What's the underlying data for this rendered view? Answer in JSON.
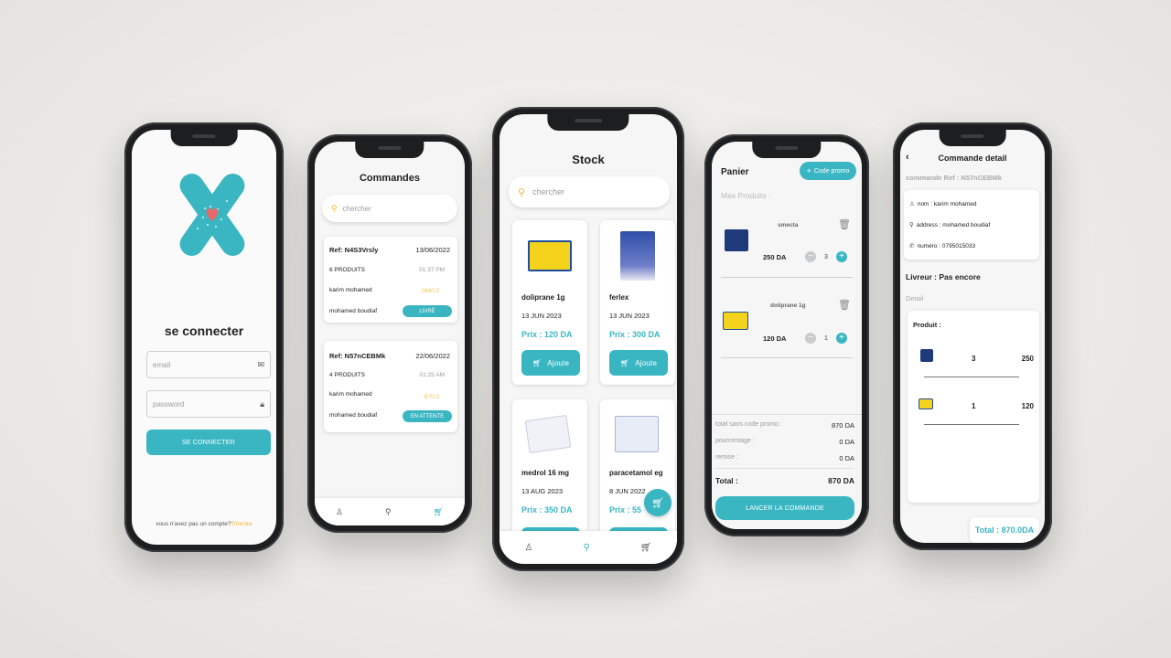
{
  "login": {
    "title": "se connecter",
    "email_placeholder": "email",
    "password_placeholder": "password",
    "button": "SE CONNECTER",
    "signup_prompt": "vous n'avez pas un compte?",
    "signup_link": "S'incrire"
  },
  "orders": {
    "title": "Commandes",
    "search_placeholder": "chercher",
    "items": [
      {
        "ref": "Ref: N4S3Vrsly",
        "date": "13/06/2022",
        "count": "6 PRODUITS",
        "time": "01:37 PM",
        "client": "karim mohamed",
        "amount": "1640.0",
        "driver": "mohamed boudiaf",
        "status": "LIVRÉ"
      },
      {
        "ref": "Ref: N57nCEBMk",
        "date": "22/06/2022",
        "count": "4 PRODUITS",
        "time": "01:25 AM",
        "client": "karim mohamed",
        "amount": "870.0",
        "driver": "mohamed boudiaf",
        "status": "EN ATTENTE"
      }
    ]
  },
  "stock": {
    "title": "Stock",
    "search_placeholder": "chercher",
    "add_label": "Ajoute",
    "products": [
      {
        "name": "doliprane 1g",
        "date": "13 JUN 2023",
        "price": "Prix : 120 DA"
      },
      {
        "name": "ferlex",
        "date": "13 JUN 2023",
        "price": "Prix : 300 DA"
      },
      {
        "name": "medrol 16 mg",
        "date": "13 AUG 2023",
        "price": "Prix : 350 DA"
      },
      {
        "name": "paracetamol eg",
        "date": "8 JUN 2022",
        "price": "Prix : 55"
      }
    ]
  },
  "cart": {
    "title": "Panier",
    "promo_button": "Code promo",
    "section_label": "Mes Produits :",
    "items": [
      {
        "name": "smecta",
        "price": "250 DA",
        "qty": "3"
      },
      {
        "name": "doliprane 1g",
        "price": "120 DA",
        "qty": "1"
      }
    ],
    "subtotal_label": "total sans code promo :",
    "subtotal_value": "870 DA",
    "percent_label": "pourcentage :",
    "percent_value": "0 DA",
    "discount_label": "remise :",
    "discount_value": "0 DA",
    "total_label": "Total :",
    "total_value": "870 DA",
    "launch_button": "LANCER LA COMMANDE"
  },
  "detail": {
    "title": "Commande detail",
    "ref": "commande Ref : N57nCEBMk",
    "name": "nom : karim mohamed",
    "address": "address : mohamed boudiaf",
    "phone": "numéro : 0795015033",
    "driver": "Livreur : Pas encore",
    "detail_label": "Detail",
    "products_label": "Produit :",
    "lines": [
      {
        "qty": "3",
        "price": "250"
      },
      {
        "qty": "1",
        "price": "120"
      }
    ],
    "total": "Total : 870.0DA"
  },
  "colors": {
    "accent": "#3ab6c3",
    "amount": "#f2c14e",
    "logo": "#3ab6c3",
    "heart": "#e46a6a"
  }
}
